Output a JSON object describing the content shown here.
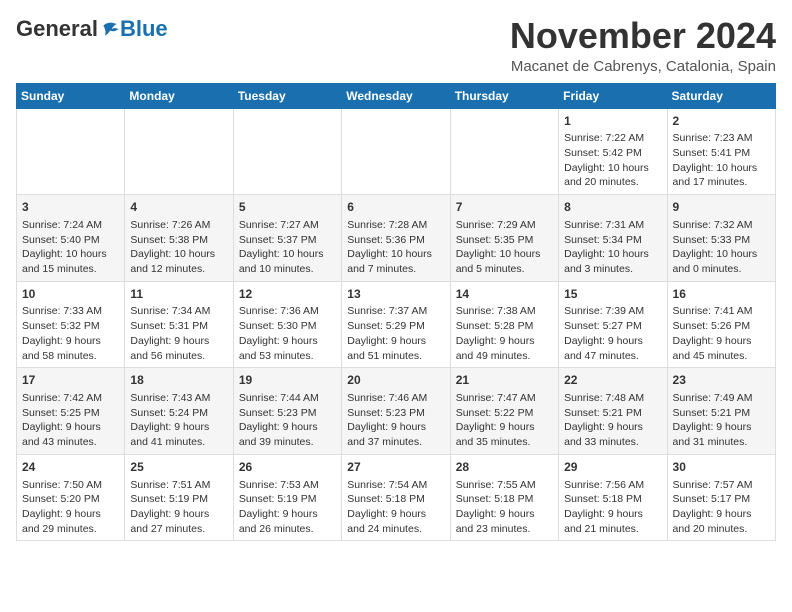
{
  "header": {
    "logo_general": "General",
    "logo_blue": "Blue",
    "month_title": "November 2024",
    "location": "Macanet de Cabrenys, Catalonia, Spain"
  },
  "calendar": {
    "days_of_week": [
      "Sunday",
      "Monday",
      "Tuesday",
      "Wednesday",
      "Thursday",
      "Friday",
      "Saturday"
    ],
    "weeks": [
      [
        {
          "day": "",
          "info": ""
        },
        {
          "day": "",
          "info": ""
        },
        {
          "day": "",
          "info": ""
        },
        {
          "day": "",
          "info": ""
        },
        {
          "day": "",
          "info": ""
        },
        {
          "day": "1",
          "info": "Sunrise: 7:22 AM\nSunset: 5:42 PM\nDaylight: 10 hours and 20 minutes."
        },
        {
          "day": "2",
          "info": "Sunrise: 7:23 AM\nSunset: 5:41 PM\nDaylight: 10 hours and 17 minutes."
        }
      ],
      [
        {
          "day": "3",
          "info": "Sunrise: 7:24 AM\nSunset: 5:40 PM\nDaylight: 10 hours and 15 minutes."
        },
        {
          "day": "4",
          "info": "Sunrise: 7:26 AM\nSunset: 5:38 PM\nDaylight: 10 hours and 12 minutes."
        },
        {
          "day": "5",
          "info": "Sunrise: 7:27 AM\nSunset: 5:37 PM\nDaylight: 10 hours and 10 minutes."
        },
        {
          "day": "6",
          "info": "Sunrise: 7:28 AM\nSunset: 5:36 PM\nDaylight: 10 hours and 7 minutes."
        },
        {
          "day": "7",
          "info": "Sunrise: 7:29 AM\nSunset: 5:35 PM\nDaylight: 10 hours and 5 minutes."
        },
        {
          "day": "8",
          "info": "Sunrise: 7:31 AM\nSunset: 5:34 PM\nDaylight: 10 hours and 3 minutes."
        },
        {
          "day": "9",
          "info": "Sunrise: 7:32 AM\nSunset: 5:33 PM\nDaylight: 10 hours and 0 minutes."
        }
      ],
      [
        {
          "day": "10",
          "info": "Sunrise: 7:33 AM\nSunset: 5:32 PM\nDaylight: 9 hours and 58 minutes."
        },
        {
          "day": "11",
          "info": "Sunrise: 7:34 AM\nSunset: 5:31 PM\nDaylight: 9 hours and 56 minutes."
        },
        {
          "day": "12",
          "info": "Sunrise: 7:36 AM\nSunset: 5:30 PM\nDaylight: 9 hours and 53 minutes."
        },
        {
          "day": "13",
          "info": "Sunrise: 7:37 AM\nSunset: 5:29 PM\nDaylight: 9 hours and 51 minutes."
        },
        {
          "day": "14",
          "info": "Sunrise: 7:38 AM\nSunset: 5:28 PM\nDaylight: 9 hours and 49 minutes."
        },
        {
          "day": "15",
          "info": "Sunrise: 7:39 AM\nSunset: 5:27 PM\nDaylight: 9 hours and 47 minutes."
        },
        {
          "day": "16",
          "info": "Sunrise: 7:41 AM\nSunset: 5:26 PM\nDaylight: 9 hours and 45 minutes."
        }
      ],
      [
        {
          "day": "17",
          "info": "Sunrise: 7:42 AM\nSunset: 5:25 PM\nDaylight: 9 hours and 43 minutes."
        },
        {
          "day": "18",
          "info": "Sunrise: 7:43 AM\nSunset: 5:24 PM\nDaylight: 9 hours and 41 minutes."
        },
        {
          "day": "19",
          "info": "Sunrise: 7:44 AM\nSunset: 5:23 PM\nDaylight: 9 hours and 39 minutes."
        },
        {
          "day": "20",
          "info": "Sunrise: 7:46 AM\nSunset: 5:23 PM\nDaylight: 9 hours and 37 minutes."
        },
        {
          "day": "21",
          "info": "Sunrise: 7:47 AM\nSunset: 5:22 PM\nDaylight: 9 hours and 35 minutes."
        },
        {
          "day": "22",
          "info": "Sunrise: 7:48 AM\nSunset: 5:21 PM\nDaylight: 9 hours and 33 minutes."
        },
        {
          "day": "23",
          "info": "Sunrise: 7:49 AM\nSunset: 5:21 PM\nDaylight: 9 hours and 31 minutes."
        }
      ],
      [
        {
          "day": "24",
          "info": "Sunrise: 7:50 AM\nSunset: 5:20 PM\nDaylight: 9 hours and 29 minutes."
        },
        {
          "day": "25",
          "info": "Sunrise: 7:51 AM\nSunset: 5:19 PM\nDaylight: 9 hours and 27 minutes."
        },
        {
          "day": "26",
          "info": "Sunrise: 7:53 AM\nSunset: 5:19 PM\nDaylight: 9 hours and 26 minutes."
        },
        {
          "day": "27",
          "info": "Sunrise: 7:54 AM\nSunset: 5:18 PM\nDaylight: 9 hours and 24 minutes."
        },
        {
          "day": "28",
          "info": "Sunrise: 7:55 AM\nSunset: 5:18 PM\nDaylight: 9 hours and 23 minutes."
        },
        {
          "day": "29",
          "info": "Sunrise: 7:56 AM\nSunset: 5:18 PM\nDaylight: 9 hours and 21 minutes."
        },
        {
          "day": "30",
          "info": "Sunrise: 7:57 AM\nSunset: 5:17 PM\nDaylight: 9 hours and 20 minutes."
        }
      ]
    ]
  }
}
